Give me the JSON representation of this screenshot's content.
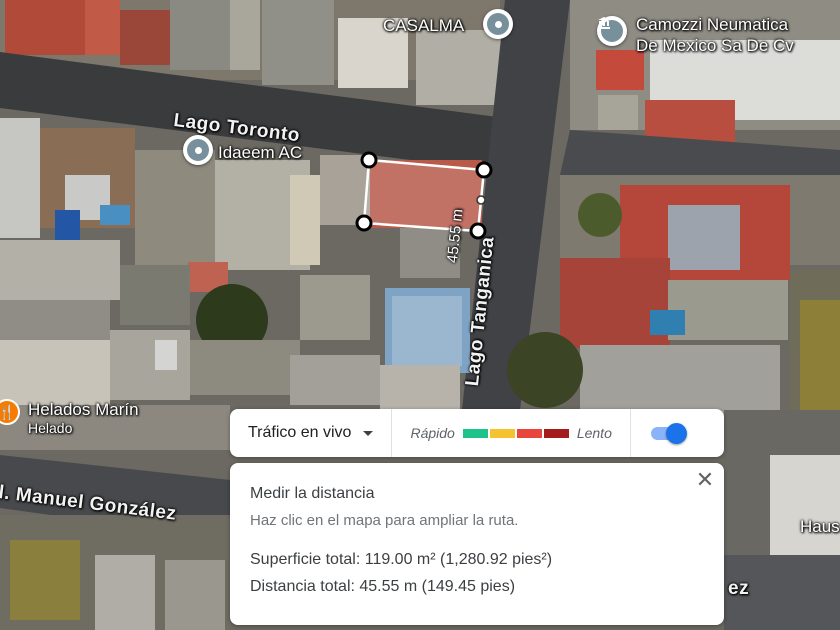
{
  "map": {
    "streets": {
      "lago_toronto": "Lago Toronto",
      "lago_tanganica": "Lago Tanganica",
      "manuel_gonzalez": "l. Manuel González",
      "partial_right": "ez"
    },
    "places": {
      "casalma": "CASALMA",
      "camozzi_line1": "Camozzi Neumatica",
      "camozzi_line2": "De Mexico Sa De Cv",
      "idaeem": "Idaeem AC",
      "helados_name": "Helados Marín",
      "helados_type": "Helado",
      "haus_partial": "Haus"
    },
    "measure_label": "45.55 m",
    "icons": {
      "place_pin": "place-pin-icon",
      "bank_pin": "bank-icon",
      "food_pin": "ice-cream-icon"
    }
  },
  "traffic": {
    "dropdown_label": "Tráfico en vivo",
    "fast_label": "Rápido",
    "slow_label": "Lento",
    "colors": [
      "#1ec28b",
      "#f5c330",
      "#e8453c",
      "#a51c1c"
    ],
    "toggle_on": true
  },
  "measure": {
    "title": "Medir la distancia",
    "hint": "Haz clic en el mapa para ampliar la ruta.",
    "area": "Superficie total: 119.00 m² (1,280.92 pies²)",
    "distance": "Distancia total: 45.55 m (149.45 pies)",
    "close_icon": "close-icon"
  }
}
